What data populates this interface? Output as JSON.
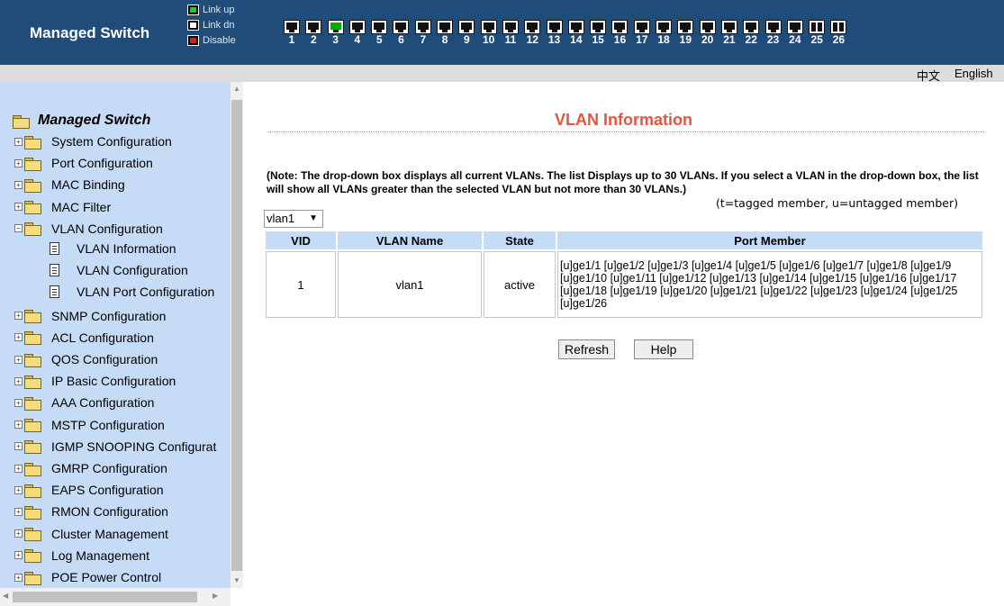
{
  "header": {
    "title": "Managed Switch",
    "legend": [
      {
        "label": "Link up",
        "icon": "port-link-up-icon"
      },
      {
        "label": "Link dn",
        "icon": "port-link-down-icon"
      },
      {
        "label": "Disable",
        "icon": "port-disable-icon"
      }
    ],
    "ports": [
      "1",
      "2",
      "3",
      "4",
      "5",
      "6",
      "7",
      "8",
      "9",
      "10",
      "11",
      "12",
      "13",
      "14",
      "15",
      "16",
      "17",
      "18",
      "19",
      "20",
      "21",
      "22",
      "23",
      "24",
      "25",
      "26"
    ],
    "colors": {
      "header_bg": "#1f4c78",
      "link_up": "#28c828",
      "disable": "#d42020"
    }
  },
  "language": {
    "chinese": "中文",
    "english": "English"
  },
  "sidebar": {
    "root": "Managed Switch",
    "items": [
      {
        "label": "System Configuration"
      },
      {
        "label": "Port Configuration"
      },
      {
        "label": "MAC Binding"
      },
      {
        "label": "MAC Filter"
      },
      {
        "label": "VLAN Configuration",
        "children": [
          "VLAN Information",
          "VLAN Configuration",
          "VLAN Port Configuration"
        ]
      },
      {
        "label": "SNMP Configuration"
      },
      {
        "label": "ACL Configuration"
      },
      {
        "label": "QOS Configuration"
      },
      {
        "label": "IP Basic Configuration"
      },
      {
        "label": "AAA Configuration"
      },
      {
        "label": "MSTP Configuration"
      },
      {
        "label": "IGMP SNOOPING Configurat"
      },
      {
        "label": "GMRP Configuration"
      },
      {
        "label": "EAPS Configuration"
      },
      {
        "label": "RMON Configuration"
      },
      {
        "label": "Cluster Management"
      },
      {
        "label": "Log Management"
      },
      {
        "label": "POE Power Control"
      }
    ]
  },
  "main": {
    "title": "VLAN Information",
    "note": "(Note: The drop-down box displays all current VLANs. The list Displays up to 30 VLANs. If you select a VLAN in the drop-down box, the list will show all VLANs greater than the selected VLAN but not more than 30 VLANs.)",
    "member_legend": "(t=tagged member, u=untagged member)",
    "vlan_select": "vlan1",
    "table": {
      "headers": [
        "VID",
        "VLAN Name",
        "State",
        "Port Member"
      ],
      "rows": [
        {
          "vid": "1",
          "name": "vlan1",
          "state": "active",
          "members": "[u]ge1/1 [u]ge1/2 [u]ge1/3 [u]ge1/4 [u]ge1/5 [u]ge1/6 [u]ge1/7 [u]ge1/8 [u]ge1/9 [u]ge1/10 [u]ge1/11 [u]ge1/12 [u]ge1/13 [u]ge1/14 [u]ge1/15 [u]ge1/16 [u]ge1/17 [u]ge1/18 [u]ge1/19 [u]ge1/20 [u]ge1/21 [u]ge1/22 [u]ge1/23 [u]ge1/24 [u]ge1/25 [u]ge1/26"
        }
      ]
    },
    "buttons": {
      "refresh": "Refresh",
      "help": "Help"
    }
  }
}
